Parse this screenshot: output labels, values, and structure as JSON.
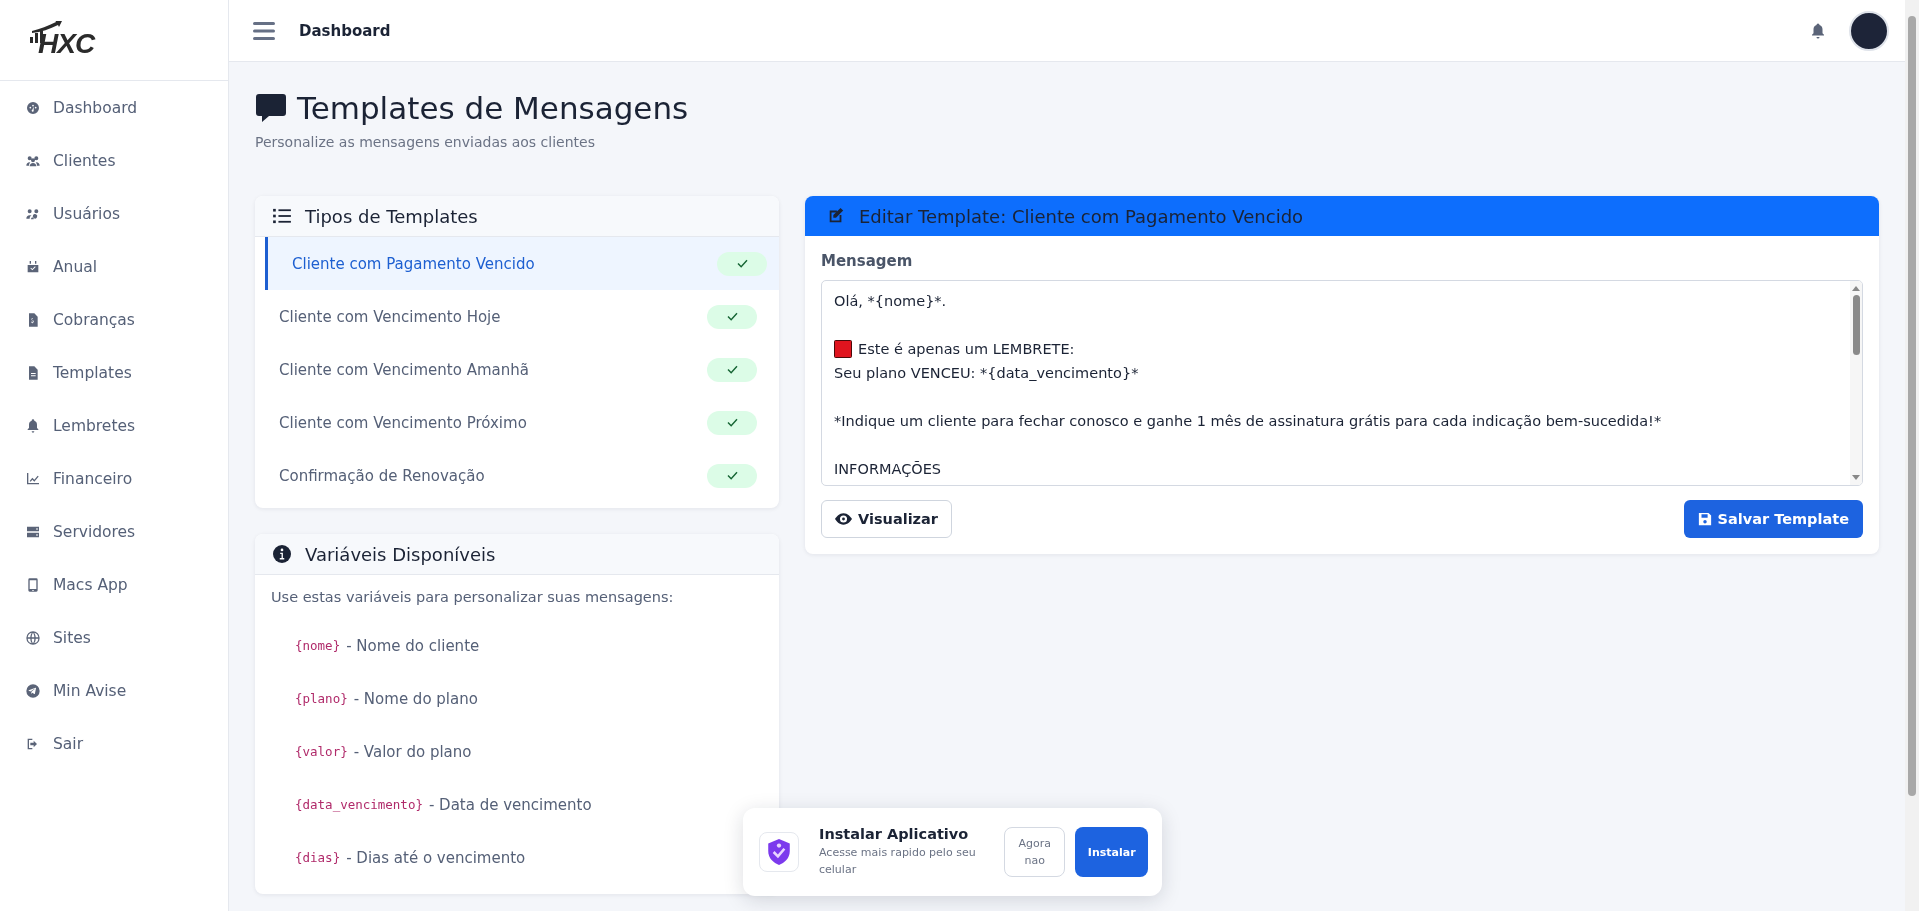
{
  "brand": "HXC",
  "sidebar": {
    "items": [
      {
        "label": "Dashboard"
      },
      {
        "label": "Clientes"
      },
      {
        "label": "Usuários"
      },
      {
        "label": "Anual"
      },
      {
        "label": "Cobranças"
      },
      {
        "label": "Templates"
      },
      {
        "label": "Lembretes"
      },
      {
        "label": "Financeiro"
      },
      {
        "label": "Servidores"
      },
      {
        "label": "Macs App"
      },
      {
        "label": "Sites"
      },
      {
        "label": "Min Avise"
      },
      {
        "label": "Sair"
      }
    ]
  },
  "header": {
    "title": "Dashboard"
  },
  "page": {
    "title": "Templates de Mensagens",
    "subtitle": "Personalize as mensagens enviadas aos clientes"
  },
  "template_types": {
    "title": "Tipos de Templates",
    "items": [
      {
        "label": "Cliente com Pagamento Vencido",
        "selected": true,
        "active": true
      },
      {
        "label": "Cliente com Vencimento Hoje",
        "selected": false,
        "active": true
      },
      {
        "label": "Cliente com Vencimento Amanhã",
        "selected": false,
        "active": true
      },
      {
        "label": "Cliente com Vencimento Próximo",
        "selected": false,
        "active": true
      },
      {
        "label": "Confirmação de Renovação",
        "selected": false,
        "active": true
      }
    ]
  },
  "variables": {
    "title": "Variáveis Disponíveis",
    "intro": "Use estas variáveis para personalizar suas mensagens:",
    "items": [
      {
        "code": "{nome}",
        "description": "- Nome do cliente"
      },
      {
        "code": "{plano}",
        "description": "- Nome do plano"
      },
      {
        "code": "{valor}",
        "description": "- Valor do plano"
      },
      {
        "code": "{data_vencimento}",
        "description": "- Data de vencimento"
      },
      {
        "code": "{dias}",
        "description": "- Dias até o vencimento"
      }
    ]
  },
  "editor": {
    "title": "Editar Template: Cliente com Pagamento Vencido",
    "label": "Mensagem",
    "lines": [
      {
        "kind": "text",
        "text": "Olá, *{nome}*."
      },
      {
        "kind": "blank"
      },
      {
        "kind": "alert",
        "text": "Este é apenas um LEMBRETE:"
      },
      {
        "kind": "text",
        "text": "Seu plano VENCEU: *{data_vencimento}*"
      },
      {
        "kind": "blank"
      },
      {
        "kind": "text",
        "text": "*Indique um cliente para fechar conosco e ganhe 1 mês de assinatura grátis para cada indicação bem-sucedida!*"
      },
      {
        "kind": "blank"
      },
      {
        "kind": "text",
        "text": "INFORMAÇÕES"
      }
    ],
    "preview_button": "Visualizar",
    "save_button": "Salvar Template"
  },
  "install_prompt": {
    "title": "Instalar Aplicativo",
    "text": "Acesse mais rapido pelo seu celular",
    "dismiss_button": "Agora nao",
    "install_button": "Instalar"
  }
}
